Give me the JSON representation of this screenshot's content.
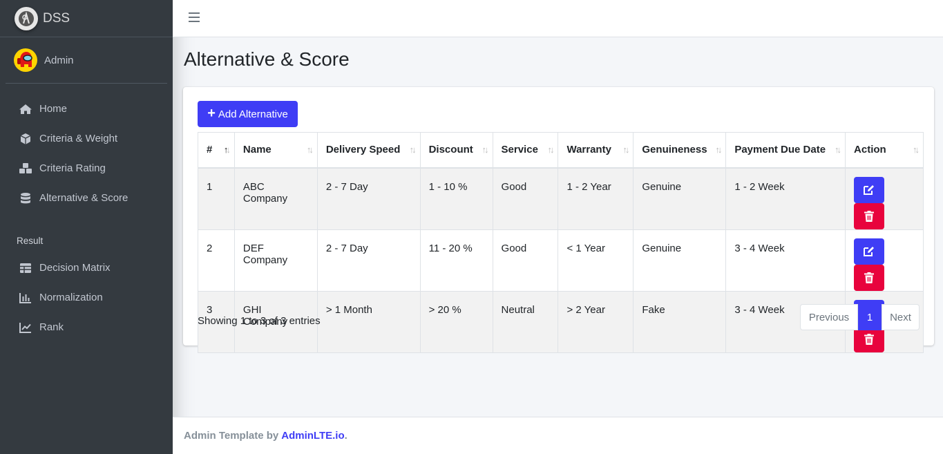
{
  "brand": {
    "name": "DSS"
  },
  "user": {
    "name": "Admin"
  },
  "sidebar": {
    "items": [
      {
        "label": "Home",
        "icon": "home-icon"
      },
      {
        "label": "Criteria & Weight",
        "icon": "cube-icon"
      },
      {
        "label": "Criteria Rating",
        "icon": "cubes-icon"
      },
      {
        "label": "Alternative & Score",
        "icon": "database-icon"
      }
    ],
    "result_header": "Result",
    "result_items": [
      {
        "label": "Decision Matrix",
        "icon": "table-icon"
      },
      {
        "label": "Normalization",
        "icon": "bar-chart-icon"
      },
      {
        "label": "Rank",
        "icon": "line-chart-icon"
      }
    ]
  },
  "page": {
    "title": "Alternative & Score"
  },
  "toolbar": {
    "add_label": "Add Alternative"
  },
  "table": {
    "columns": [
      "#",
      "Name",
      "Delivery Speed",
      "Discount",
      "Service",
      "Warranty",
      "Genuineness",
      "Payment Due Date",
      "Action"
    ],
    "rows": [
      [
        "1",
        "ABC Company",
        "2 - 7 Day",
        "1 - 10 %",
        "Good",
        "1 - 2 Year",
        "Genuine",
        "1 - 2 Week"
      ],
      [
        "2",
        "DEF Company",
        "2 - 7 Day",
        "11 - 20 %",
        "Good",
        "< 1 Year",
        "Genuine",
        "3 - 4 Week"
      ],
      [
        "3",
        "GHI Company",
        "> 1 Month",
        "> 20 %",
        "Neutral",
        "> 2 Year",
        "Fake",
        "3 - 4 Week"
      ]
    ]
  },
  "pagination": {
    "info": "Showing 1 to 3 of 3 entries",
    "previous": "Previous",
    "current": "1",
    "next": "Next"
  },
  "footer": {
    "text": "Admin Template by",
    "link": "AdminLTE.io",
    "suffix": "."
  },
  "colors": {
    "primary": "#3f3df5",
    "danger": "#e8033d",
    "sidebar": "#343a40"
  }
}
